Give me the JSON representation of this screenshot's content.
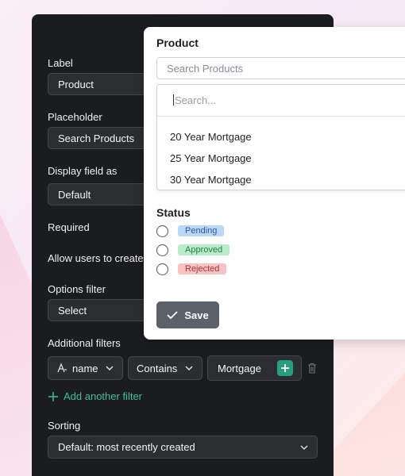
{
  "settings": {
    "label": {
      "title": "Label",
      "value": "Product"
    },
    "placeholder": {
      "title": "Placeholder",
      "value": "Search Products"
    },
    "display_field": {
      "title": "Display field as",
      "value": "Default"
    },
    "required": {
      "title": "Required"
    },
    "allow_create": {
      "title": "Allow users to create"
    },
    "options_filter": {
      "title": "Options filter",
      "value": "Select"
    },
    "additional_filters": {
      "title": "Additional filters",
      "field": "name",
      "operator": "Contains",
      "value": "Mortgage",
      "add_label": "Add another filter"
    },
    "sorting": {
      "title": "Sorting",
      "value": "Default: most recently created"
    }
  },
  "card": {
    "title": "Product",
    "search_placeholder": "Search Products",
    "dropdown_placeholder": "Search...",
    "options": [
      "20 Year Mortgage",
      "25 Year Mortgage",
      "30 Year Mortgage"
    ],
    "status_title": "Status",
    "statuses": [
      {
        "label": "Pending",
        "bg": "#bcd6f7",
        "fg": "#2c5aa0"
      },
      {
        "label": "Approved",
        "bg": "#b9ecc9",
        "fg": "#25794a"
      },
      {
        "label": "Rejected",
        "bg": "#f8c3c3",
        "fg": "#a33838"
      }
    ],
    "save_label": "Save"
  },
  "colors": {
    "accent": "#3fbf9a",
    "teal_button": "#2a9d7f",
    "dark_panel": "#1b1c1f",
    "save_button": "#5b6069"
  }
}
